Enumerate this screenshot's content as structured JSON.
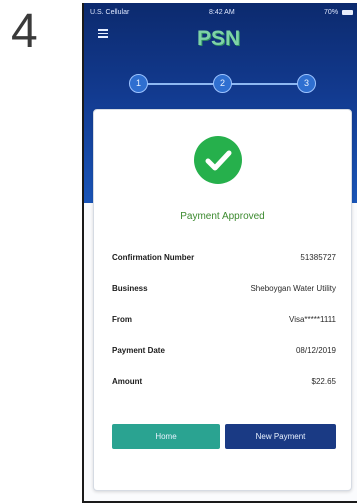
{
  "step_number": "4",
  "status_bar": {
    "carrier": "U.S. Cellular",
    "time": "8:42 AM",
    "battery": "70%"
  },
  "app": {
    "logo": "PSN"
  },
  "stepper": {
    "steps": [
      "1",
      "2",
      "3"
    ],
    "current": 3
  },
  "confirmation": {
    "title": "Payment Approved",
    "rows": [
      {
        "label": "Confirmation Number",
        "value": "51385727"
      },
      {
        "label": "Business",
        "value": "Sheboygan Water Utility"
      },
      {
        "label": "From",
        "value": "Visa*****1111"
      },
      {
        "label": "Payment Date",
        "value": "08/12/2019"
      },
      {
        "label": "Amount",
        "value": "$22.65"
      }
    ]
  },
  "buttons": {
    "home": "Home",
    "new_payment": "New Payment"
  },
  "colors": {
    "success": "#26b04c",
    "home_button": "#2aa391",
    "new_payment_button": "#1a3a84",
    "header": "#123a8f"
  }
}
